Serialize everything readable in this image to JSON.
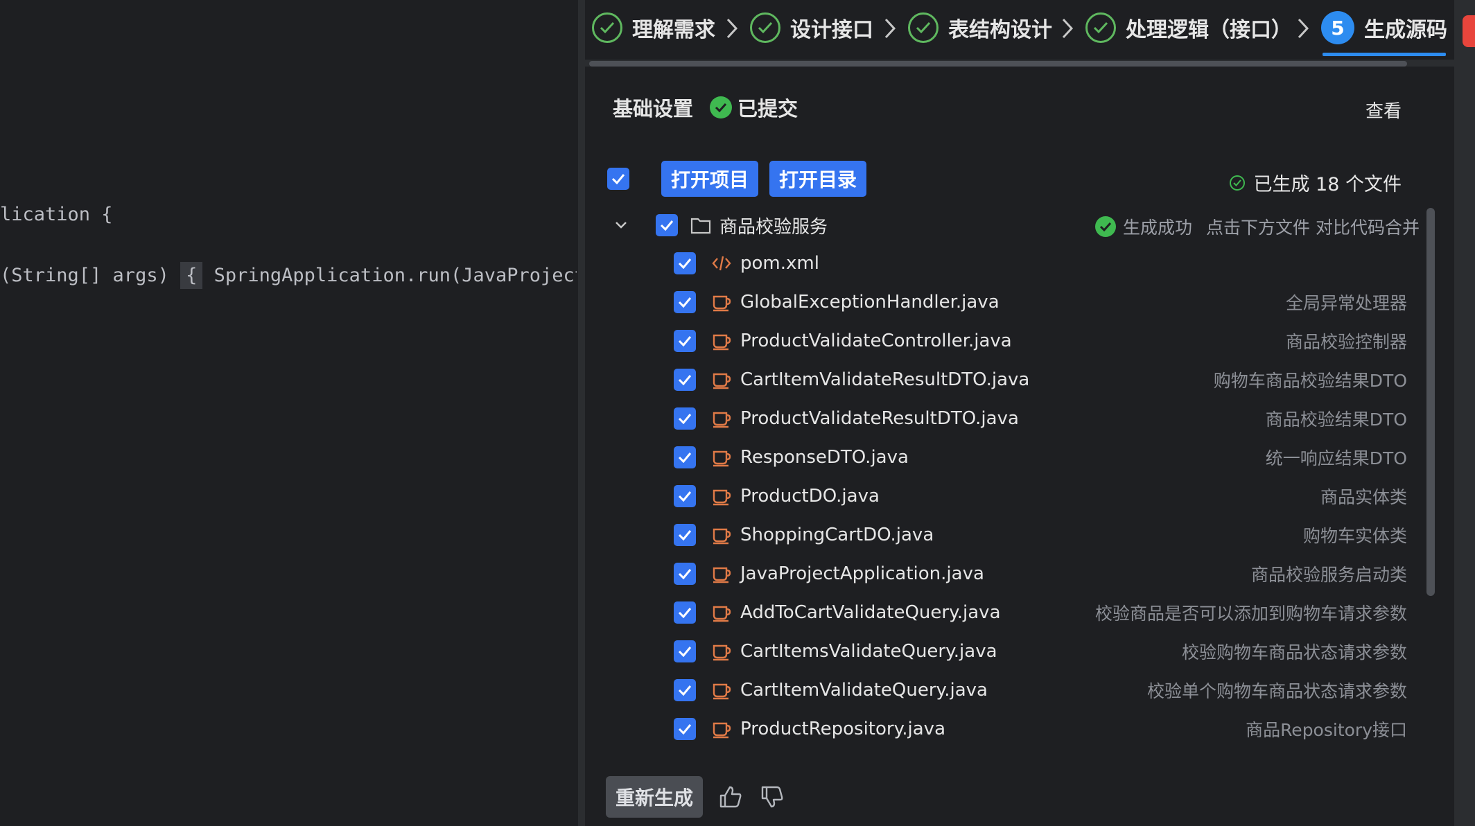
{
  "editor": {
    "line1": "lication {",
    "line2_prefix": "(String[] args) ",
    "line2_brace": "{",
    "line2_suffix": " SpringApplication.run(JavaProjectA"
  },
  "stepper": {
    "steps": [
      {
        "label": "理解需求",
        "state": "done"
      },
      {
        "label": "设计接口",
        "state": "done"
      },
      {
        "label": "表结构设计",
        "state": "done"
      },
      {
        "label": "处理逻辑（接口）",
        "state": "done"
      },
      {
        "label": "生成源码",
        "state": "active",
        "number": "5"
      }
    ]
  },
  "basic": {
    "title": "基础设置",
    "status": "已提交",
    "view": "查看"
  },
  "toolbar": {
    "open_project": "打开项目",
    "open_dir": "打开目录",
    "generated": "已生成 18 个文件"
  },
  "folder": {
    "name": "商品校验服务",
    "status": "生成成功",
    "hint": "点击下方文件 对比代码合并"
  },
  "files": [
    {
      "name": "pom.xml",
      "desc": "",
      "icon": "xml-code-icon"
    },
    {
      "name": "GlobalExceptionHandler.java",
      "desc": "全局异常处理器",
      "icon": "java-cup-icon"
    },
    {
      "name": "ProductValidateController.java",
      "desc": "商品校验控制器",
      "icon": "java-cup-icon"
    },
    {
      "name": "CartItemValidateResultDTO.java",
      "desc": "购物车商品校验结果DTO",
      "icon": "java-cup-icon"
    },
    {
      "name": "ProductValidateResultDTO.java",
      "desc": "商品校验结果DTO",
      "icon": "java-cup-icon"
    },
    {
      "name": "ResponseDTO.java",
      "desc": "统一响应结果DTO",
      "icon": "java-cup-icon"
    },
    {
      "name": "ProductDO.java",
      "desc": "商品实体类",
      "icon": "java-cup-icon"
    },
    {
      "name": "ShoppingCartDO.java",
      "desc": "购物车实体类",
      "icon": "java-cup-icon"
    },
    {
      "name": "JavaProjectApplication.java",
      "desc": "商品校验服务启动类",
      "icon": "java-cup-icon"
    },
    {
      "name": "AddToCartValidateQuery.java",
      "desc": "校验商品是否可以添加到购物车请求参数",
      "icon": "java-cup-icon"
    },
    {
      "name": "CartItemsValidateQuery.java",
      "desc": "校验购物车商品状态请求参数",
      "icon": "java-cup-icon"
    },
    {
      "name": "CartItemValidateQuery.java",
      "desc": "校验单个购物车商品状态请求参数",
      "icon": "java-cup-icon"
    },
    {
      "name": "ProductRepository.java",
      "desc": "商品Repository接口",
      "icon": "java-cup-icon"
    }
  ],
  "actions": {
    "regenerate": "重新生成"
  },
  "colors": {
    "accent": "#3574f0",
    "step_active": "#2d8cf0",
    "success": "#3fb950",
    "java_icon": "#e07a47"
  }
}
